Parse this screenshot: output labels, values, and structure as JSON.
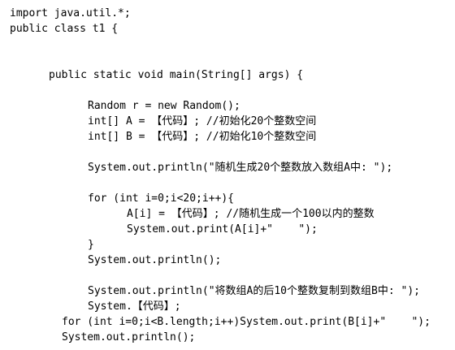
{
  "code_lines": [
    "import java.util.*;",
    "public class t1 {",
    "public static void main(String[] args) {",
    "Random r = new Random();",
    "int[] A = 【代码】; //初始化20个整数空间",
    "int[] B = 【代码】; //初始化10个整数空间",
    "System.out.println(\"随机生成20个整数放入数组A中: \");",
    "for (int i=0;i<20;i++){",
    "A[i] = 【代码】; //随机生成一个100以内的整数",
    "System.out.print(A[i]+\"    \");",
    "}",
    "System.out.println();",
    "System.out.println(\"将数组A的后10个整数复制到数组B中: \");",
    "System.【代码】;",
    "for (int i=0;i<B.length;i++)System.out.print(B[i]+\"    \");",
    "System.out.println();"
  ]
}
